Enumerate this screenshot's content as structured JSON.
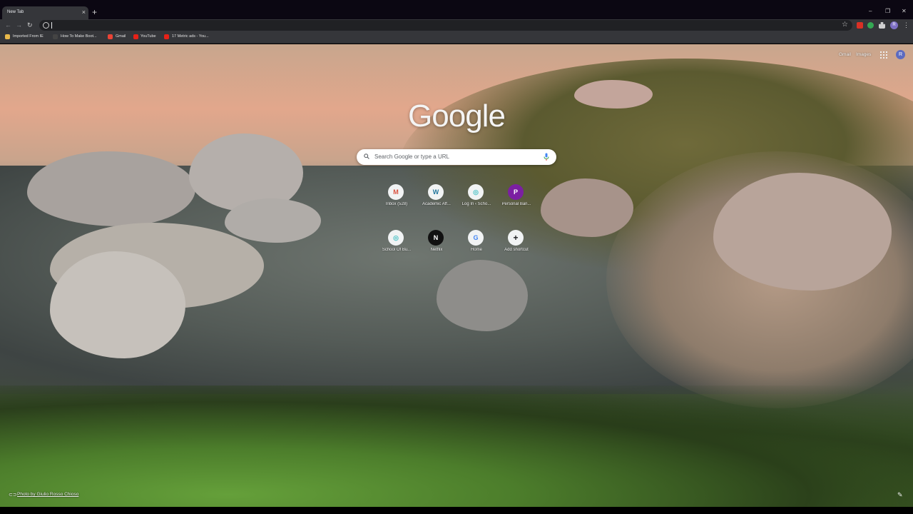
{
  "browser": {
    "tab": {
      "title": "New Tab",
      "close": "×"
    },
    "new_tab": "+",
    "window_controls": {
      "minimize": "–",
      "maximize": "❐",
      "close": "✕"
    },
    "nav": {
      "back": "←",
      "forward": "→",
      "reload": "↻"
    },
    "omnibox": {
      "value": ""
    },
    "bookmark_star": "☆",
    "profile_initial": "R",
    "menu": "⋮"
  },
  "bookmarks": [
    {
      "label": "Imported From IE",
      "color": "#e8b84a"
    },
    {
      "label": "How To Make Boot...",
      "color": "#444444"
    },
    {
      "label": "Gmail",
      "color": "#d9503f"
    },
    {
      "label": "YouTube",
      "color": "#e62117"
    },
    {
      "label": "17 Metric ads - You...",
      "color": "#e62117"
    }
  ],
  "ntp": {
    "links": {
      "gmail": "Gmail",
      "images": "Images"
    },
    "avatar_initial": "R",
    "logo": "Google",
    "search_placeholder": "Search Google or type a URL",
    "shortcuts": [
      {
        "label": "Inbox (528)",
        "glyph": "M",
        "color": "#d9503f"
      },
      {
        "label": "Academic Aff...",
        "glyph": "W",
        "color": "#21759b"
      },
      {
        "label": "Log In ‹ Scho...",
        "glyph": "◎",
        "color": "#4fc3c7"
      },
      {
        "label": "Personal Ban...",
        "glyph": "P",
        "color": "#7b1fa2"
      },
      {
        "label": "School Of Bu...",
        "glyph": "◎",
        "color": "#4fc3c7"
      },
      {
        "label": "Netflix",
        "glyph": "N",
        "color": "#111111"
      },
      {
        "label": "Home",
        "glyph": "G",
        "color": "#4285f4"
      },
      {
        "label": "Add shortcut",
        "glyph": "+",
        "color": "#202124"
      }
    ],
    "photo_credit": "Photo by Giulio Rosso Chioso",
    "edit_icon": "✎"
  }
}
